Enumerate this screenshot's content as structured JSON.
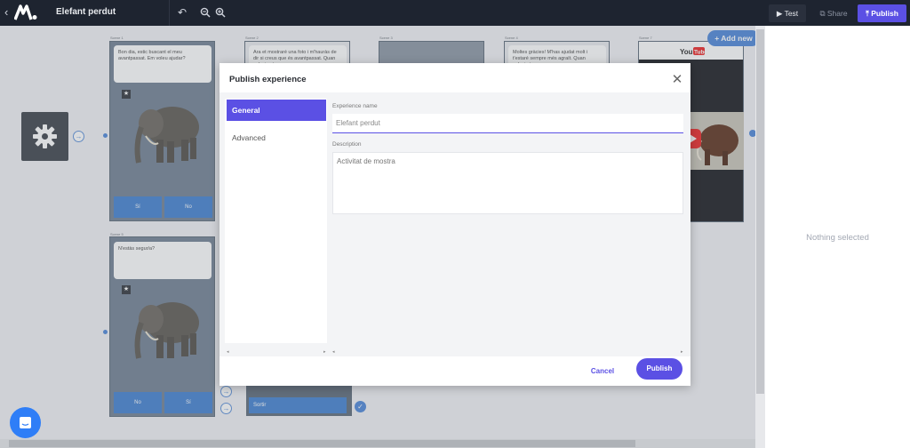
{
  "app": {
    "title": "Elefant perdut"
  },
  "toolbar": {
    "test_label": "Test",
    "share_label": "Share",
    "publish_label": "Publish",
    "accent": "#5b50e4"
  },
  "canvas": {
    "add_new_label": "+ Add new",
    "scenes": [
      {
        "label": "Scene 1",
        "speech": "Bon dia, estic buscant el meu avantpassat. Em voleu ajudar?",
        "choices": [
          "Sí",
          "No"
        ]
      },
      {
        "label": "Scene 2",
        "speech": "Ara et mostraré una foto i m'hauràs de dir si creus que és avantpassat. Quan vulguis et ...",
        "choices": []
      },
      {
        "label": "Scene 3",
        "speech": "",
        "choices": []
      },
      {
        "label": "Scene 4",
        "speech": "Moltes gràcies! M'has ajudat molt i t'estaré sempre més agraït. Quan vulguis tornar a ...",
        "choices": []
      },
      {
        "label": "Scene 7",
        "speech": "",
        "choices": []
      },
      {
        "label": "Scene 5",
        "speech": "N'estàs segur/a?",
        "choices": [
          "No",
          "Sí"
        ]
      },
      {
        "label": "Scene 6",
        "speech": "",
        "choices": [
          "Sortir"
        ]
      }
    ]
  },
  "right_panel": {
    "empty_text": "Nothing selected"
  },
  "modal": {
    "title": "Publish experience",
    "tabs": [
      {
        "label": "General"
      },
      {
        "label": "Advanced"
      }
    ],
    "fields": {
      "name_label": "Experience name",
      "name_value": "Elefant perdut",
      "description_label": "Description",
      "description_value": "Activitat de mostra"
    },
    "cancel_label": "Cancel",
    "publish_label": "Publish"
  }
}
